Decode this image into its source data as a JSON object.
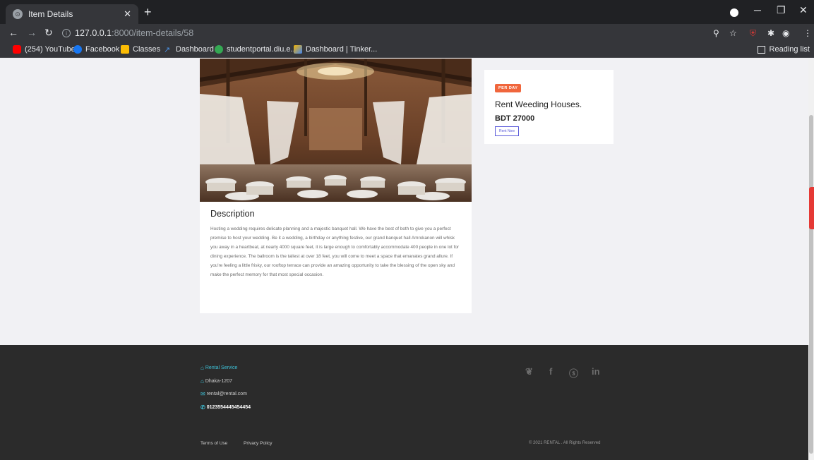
{
  "browser": {
    "tab_title": "Item Details",
    "url_host": "127.0.0.1",
    "url_path": ":8000/item-details/58",
    "bookmarks": [
      {
        "label": "(254) YouTube",
        "color": "#ff0000"
      },
      {
        "label": "Facebook",
        "color": "#1877f2"
      },
      {
        "label": "Classes",
        "color": "#fbbc04"
      },
      {
        "label": "Dashboard",
        "color": "#4a90e2"
      },
      {
        "label": "studentportal.diu.e...",
        "color": "#34a853"
      },
      {
        "label": "Dashboard | Tinker...",
        "color": "#f4b400"
      }
    ],
    "reading_list": "Reading list"
  },
  "item": {
    "badge": "PER DAY",
    "title": "Rent Weeding Houses.",
    "price": "BDT 27000",
    "rent_button": "Rent Now"
  },
  "description": {
    "heading": "Description",
    "text": "Hosting a wedding requires delicate planning and a majestic banquet hall. We have the best of both to give you a perfect premise to host your wedding. Be it a wedding, a birthday or anything festive, our grand banquet hall Amrokanon will whisk you away in a heartbeat, at nearly 4000 square feet, it is large enough to comfortably accommodate 400 people in one lot for dining experience. The ballroom is the tallest at over 18 feet, you will come to meet a space that emanates grand allure. If you're feeling a little frisky, our rooftop terrace can provide an amazing opportunity to take the blessing of the open sky and make the perfect memory for that most special occasion."
  },
  "footer": {
    "brand": "Rental Service",
    "address": "Dhaka-1207",
    "email": "rental@rental.com",
    "phone": "0123554445454454",
    "social": [
      "twitter-icon",
      "facebook-icon",
      "skype-icon",
      "linkedin-icon"
    ],
    "copyright": "© 2021 RENTAL . All Rights Reserved",
    "terms": "Terms of Use",
    "privacy": "Privacy Policy"
  },
  "colors": {
    "accent": "#f0663c",
    "link": "#3ec2d8",
    "button": "#5a5ad9",
    "footer_bg": "#2b2b2b"
  }
}
